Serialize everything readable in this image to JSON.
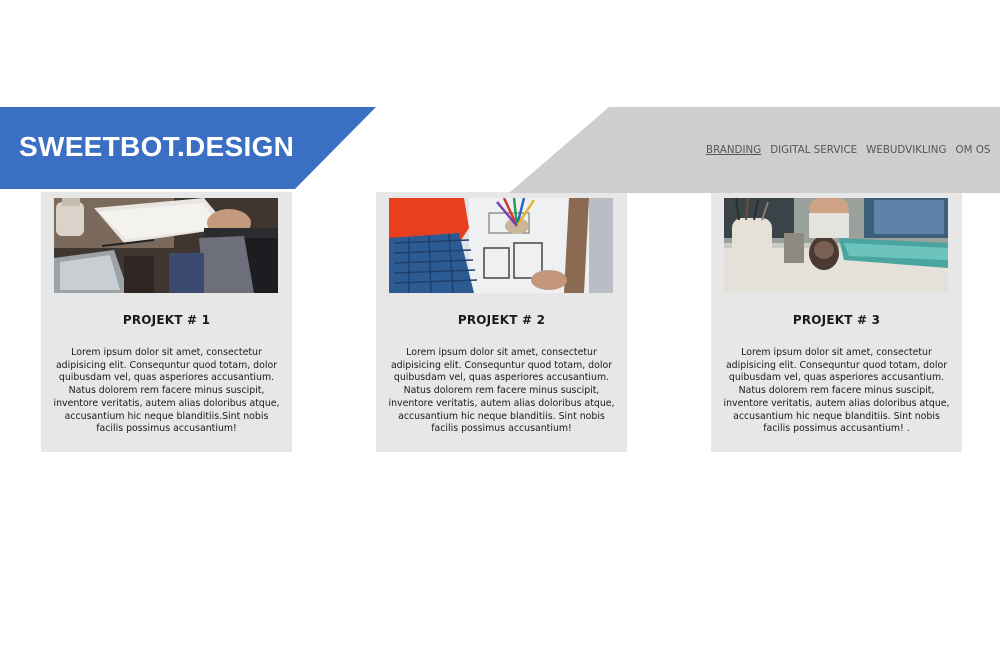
{
  "header": {
    "logo": "SWEETBOT.DESIGN",
    "brand_color": "#3a6fc4",
    "nav_band_color": "#cfcdcd"
  },
  "nav": {
    "items": [
      {
        "label": "BRANDING",
        "active": true
      },
      {
        "label": "DIGITAL SERVICE",
        "active": false
      },
      {
        "label": "WEBUDVIKLING",
        "active": false
      },
      {
        "label": "OM OS",
        "active": false
      }
    ]
  },
  "projects": [
    {
      "title": "PROJEKT # 1",
      "image_icon": "notebook-laptop-photo",
      "text": "Lorem ipsum dolor sit amet, consectetur adipisicing elit. Consequntur quod totam, dolor quibusdam vel, quas asperiores accusantium. Natus dolorem rem facere minus suscipit, inventore veritatis, autem alias doloribus atque, accusantium hic neque blanditiis.Sint nobis facilis possimus accusantium!"
    },
    {
      "title": "PROJEKT # 2",
      "image_icon": "blueprint-pencils-photo",
      "text": "Lorem ipsum dolor sit amet, consectetur adipisicing elit. Consequntur quod totam, dolor quibusdam vel, quas asperiores accusantium. Natus dolorem rem facere minus suscipit, inventore veritatis, autem alias doloribus atque, accusantium hic neque blanditiis. Sint nobis facilis possimus accusantium!"
    },
    {
      "title": "PROJEKT # 3",
      "image_icon": "desk-workspace-photo",
      "text": "Lorem ipsum dolor sit amet, consectetur adipisicing elit. Consequntur quod totam, dolor quibusdam vel, quas asperiores accusantium. Natus dolorem rem facere minus suscipit, inventore veritatis, autem alias doloribus atque, accusantium hic neque blanditiis. Sint nobis facilis possimus accusantium! ."
    }
  ]
}
